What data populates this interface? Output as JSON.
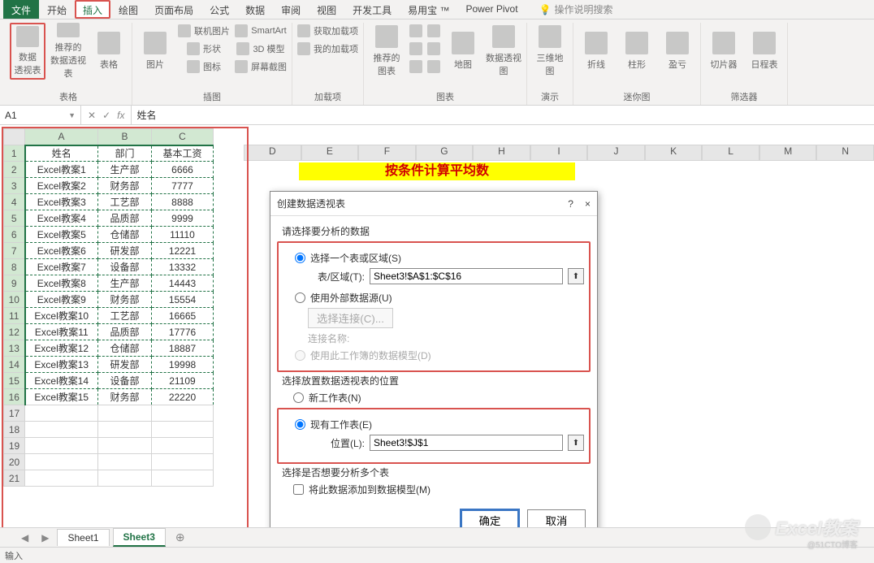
{
  "tabs": {
    "file": "文件",
    "home": "开始",
    "insert": "插入",
    "draw": "绘图",
    "layout": "页面布局",
    "formulas": "公式",
    "data": "数据",
    "review": "审阅",
    "view": "视图",
    "dev": "开发工具",
    "addin": "易用宝 ™",
    "pivot": "Power Pivot",
    "search_hint": "操作说明搜索"
  },
  "ribbon": {
    "g1": {
      "label": "表格",
      "pivot": "数据\n透视表",
      "rec": "推荐的\n数据透视表",
      "table": "表格"
    },
    "g2": {
      "label": "插图",
      "pic": "图片",
      "online": "联机图片",
      "shape": "形状",
      "icon": "图标",
      "smart": "SmartArt",
      "model": "3D 模型",
      "screen": "屏幕截图"
    },
    "g3": {
      "label": "加载项",
      "get": "获取加载项",
      "my": "我的加载项"
    },
    "g4": {
      "label": "图表",
      "rec": "推荐的\n图表",
      "map": "地图",
      "pivotchart": "数据透视图"
    },
    "g5": {
      "label": "演示",
      "three": "三维地\n图"
    },
    "g6": {
      "label": "迷你图",
      "line": "折线",
      "col": "柱形",
      "win": "盈亏"
    },
    "g7": {
      "label": "筛选器",
      "slicer": "切片器",
      "time": "日程表"
    }
  },
  "formula": {
    "cell": "A1",
    "value": "姓名",
    "fx": "fx"
  },
  "cols": [
    "A",
    "B",
    "C",
    "D",
    "E",
    "F",
    "G",
    "H",
    "I",
    "J",
    "K",
    "L",
    "M",
    "N"
  ],
  "table": {
    "headers": [
      "姓名",
      "部门",
      "基本工资"
    ],
    "rows": [
      [
        "Excel教案1",
        "生产部",
        "6666"
      ],
      [
        "Excel教案2",
        "财务部",
        "7777"
      ],
      [
        "Excel教案3",
        "工艺部",
        "8888"
      ],
      [
        "Excel教案4",
        "品质部",
        "9999"
      ],
      [
        "Excel教案5",
        "仓储部",
        "11110"
      ],
      [
        "Excel教案6",
        "研发部",
        "12221"
      ],
      [
        "Excel教案7",
        "设备部",
        "13332"
      ],
      [
        "Excel教案8",
        "生产部",
        "14443"
      ],
      [
        "Excel教案9",
        "财务部",
        "15554"
      ],
      [
        "Excel教案10",
        "工艺部",
        "16665"
      ],
      [
        "Excel教案11",
        "品质部",
        "17776"
      ],
      [
        "Excel教案12",
        "仓储部",
        "18887"
      ],
      [
        "Excel教案13",
        "研发部",
        "19998"
      ],
      [
        "Excel教案14",
        "设备部",
        "21109"
      ],
      [
        "Excel教案15",
        "财务部",
        "22220"
      ]
    ]
  },
  "banner": "按条件计算平均数",
  "dialog": {
    "title": "创建数据透视表",
    "help": "?",
    "close": "×",
    "sec1": "请选择要分析的数据",
    "opt1": "选择一个表或区域(S)",
    "range_lbl": "表/区域(T):",
    "range_val": "Sheet3!$A$1:$C$16",
    "opt2": "使用外部数据源(U)",
    "conn_btn": "选择连接(C)...",
    "conn_name": "连接名称:",
    "opt3": "使用此工作簿的数据模型(D)",
    "sec2": "选择放置数据透视表的位置",
    "opt4": "新工作表(N)",
    "opt5": "现有工作表(E)",
    "loc_lbl": "位置(L):",
    "loc_val": "Sheet3!$J$1",
    "sec3": "选择是否想要分析多个表",
    "chk": "将此数据添加到数据模型(M)",
    "ok": "确定",
    "cancel": "取消"
  },
  "sheets": {
    "s1": "Sheet1",
    "s3": "Sheet3",
    "plus": "⊕"
  },
  "status": "输入",
  "watermark": {
    "text": "Excel教案",
    "sub": "@51CTO博客"
  }
}
